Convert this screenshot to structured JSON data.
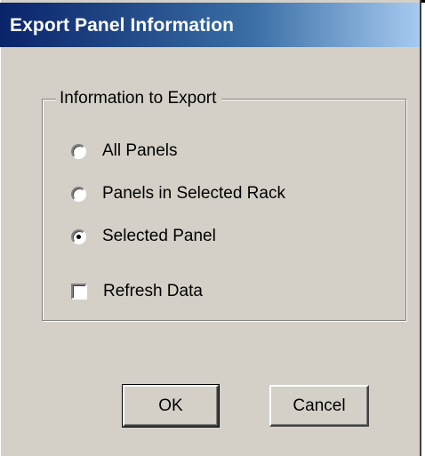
{
  "window": {
    "title": "Export Panel Information"
  },
  "group": {
    "label": "Information to Export",
    "options": [
      {
        "label": "All Panels",
        "selected": false
      },
      {
        "label": "Panels in Selected Rack",
        "selected": false
      },
      {
        "label": "Selected Panel",
        "selected": true
      }
    ],
    "refresh": {
      "label": "Refresh Data",
      "checked": false
    }
  },
  "buttons": {
    "ok": "OK",
    "cancel": "Cancel"
  }
}
